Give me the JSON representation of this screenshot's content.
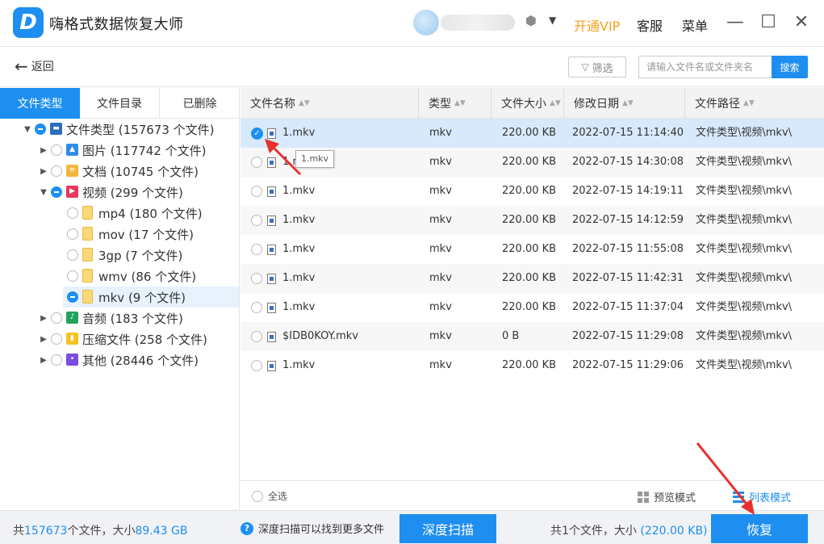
{
  "app": {
    "logo_letter": "D",
    "title": "嗨格式数据恢复大师",
    "vip_link": "开通VIP",
    "service_link": "客服",
    "menu_link": "菜单",
    "vip_color": "#f4a11a",
    "accent": "#1e8ff0"
  },
  "toolbar": {
    "back_label": "返回",
    "filter_label": "筛选",
    "search_placeholder": "请输入文件名或文件夹名",
    "search_button": "搜索"
  },
  "tabs": [
    {
      "label": "文件类型",
      "active": true
    },
    {
      "label": "文件目录",
      "active": false
    },
    {
      "label": "已删除",
      "active": false
    }
  ],
  "tree": [
    {
      "label": "文件类型 (157673 个文件)",
      "state": "partial",
      "expanded": true,
      "icon": "computer-icon"
    },
    {
      "label": "图片 (117742 个文件)",
      "state": "none",
      "expanded": false,
      "icon": "image-icon"
    },
    {
      "label": "文档 (10745 个文件)",
      "state": "none",
      "expanded": false,
      "icon": "document-icon"
    },
    {
      "label": "视频 (299 个文件)",
      "state": "partial",
      "expanded": true,
      "icon": "video-icon"
    },
    {
      "label": "mp4 (180 个文件)",
      "state": "none",
      "icon": "folder-icon"
    },
    {
      "label": "mov (17 个文件)",
      "state": "none",
      "icon": "folder-icon"
    },
    {
      "label": "3gp (7 个文件)",
      "state": "none",
      "icon": "folder-icon"
    },
    {
      "label": "wmv (86 个文件)",
      "state": "none",
      "icon": "folder-icon"
    },
    {
      "label": "mkv (9 个文件)",
      "state": "partial",
      "icon": "folder-icon",
      "selected": true
    },
    {
      "label": "音频 (183 个文件)",
      "state": "none",
      "expanded": false,
      "icon": "audio-icon"
    },
    {
      "label": "压缩文件 (258 个文件)",
      "state": "none",
      "expanded": false,
      "icon": "archive-icon"
    },
    {
      "label": "其他 (28446 个文件)",
      "state": "none",
      "expanded": false,
      "icon": "other-icon"
    }
  ],
  "columns": [
    "文件名称",
    "类型",
    "文件大小",
    "修改日期",
    "文件路径"
  ],
  "files": [
    {
      "name": "1.mkv",
      "type": "mkv",
      "size": "220.00 KB",
      "date": "2022-07-15 11:14:40",
      "path": "文件类型\\视频\\mkv\\",
      "checked": true
    },
    {
      "name": "1.mkv",
      "type": "mkv",
      "size": "220.00 KB",
      "date": "2022-07-15 14:30:08",
      "path": "文件类型\\视频\\mkv\\",
      "checked": false
    },
    {
      "name": "1.mkv",
      "type": "mkv",
      "size": "220.00 KB",
      "date": "2022-07-15 14:19:11",
      "path": "文件类型\\视频\\mkv\\",
      "checked": false
    },
    {
      "name": "1.mkv",
      "type": "mkv",
      "size": "220.00 KB",
      "date": "2022-07-15 14:12:59",
      "path": "文件类型\\视频\\mkv\\",
      "checked": false
    },
    {
      "name": "1.mkv",
      "type": "mkv",
      "size": "220.00 KB",
      "date": "2022-07-15 11:55:08",
      "path": "文件类型\\视频\\mkv\\",
      "checked": false
    },
    {
      "name": "1.mkv",
      "type": "mkv",
      "size": "220.00 KB",
      "date": "2022-07-15 11:42:31",
      "path": "文件类型\\视频\\mkv\\",
      "checked": false
    },
    {
      "name": "1.mkv",
      "type": "mkv",
      "size": "220.00 KB",
      "date": "2022-07-15 11:37:04",
      "path": "文件类型\\视频\\mkv\\",
      "checked": false
    },
    {
      "name": "$IDB0KOY.mkv",
      "type": "mkv",
      "size": "0 B",
      "date": "2022-07-15 11:29:08",
      "path": "文件类型\\视频\\mkv\\",
      "checked": false
    },
    {
      "name": "1.mkv",
      "type": "mkv",
      "size": "220.00 KB",
      "date": "2022-07-15 11:29:06",
      "path": "文件类型\\视频\\mkv\\",
      "checked": false
    }
  ],
  "tooltip": "1.mkv",
  "list_footer": {
    "select_all": "全选",
    "preview_mode": "预览模式",
    "list_mode": "列表模式"
  },
  "status": {
    "total_prefix": "共",
    "total_count": "157673",
    "total_mid": "个文件，大小",
    "total_size": "89.43 GB",
    "hint": "深度扫描可以找到更多文件",
    "deep_scan": "深度扫描",
    "selected_prefix": "共1个文件，大小",
    "selected_size": "(220.00 KB)",
    "recover": "恢复"
  }
}
